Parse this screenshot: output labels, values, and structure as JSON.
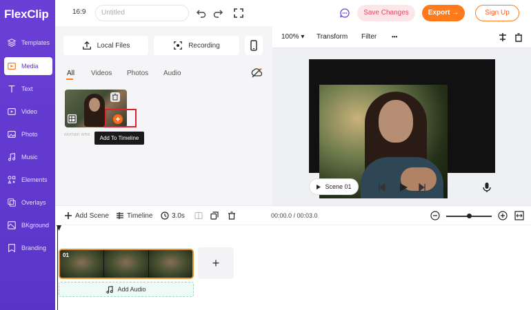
{
  "app": {
    "logo_text": "FlexClip"
  },
  "sidebar": {
    "items": [
      {
        "label": "Templates",
        "icon": "layers-icon"
      },
      {
        "label": "Media",
        "icon": "media-folder-icon"
      },
      {
        "label": "Text",
        "icon": "text-icon"
      },
      {
        "label": "Video",
        "icon": "video-icon"
      },
      {
        "label": "Photo",
        "icon": "photo-icon"
      },
      {
        "label": "Music",
        "icon": "music-icon"
      },
      {
        "label": "Elements",
        "icon": "elements-icon"
      },
      {
        "label": "Overlays",
        "icon": "overlays-icon"
      },
      {
        "label": "BKground",
        "icon": "background-icon"
      },
      {
        "label": "Branding",
        "icon": "branding-icon"
      }
    ],
    "active": "Media"
  },
  "header": {
    "ratio": "16:9",
    "title_placeholder": "Untitled",
    "save_label": "Save Changes",
    "export_label": "Export →",
    "signup_label": "Sign Up"
  },
  "media_panel": {
    "local_files_label": "Local Files",
    "recording_label": "Recording",
    "tabs": [
      "All",
      "Videos",
      "Photos",
      "Audio"
    ],
    "active_tab": "All",
    "thumb_caption": "woman wea",
    "tooltip": "Add To Timeline"
  },
  "preview": {
    "zoom": "100%",
    "transform_label": "Transform",
    "filter_label": "Filter",
    "more_label": "•••",
    "scene_label": "Scene 01"
  },
  "timeline": {
    "add_scene_label": "Add Scene",
    "timeline_label": "Timeline",
    "duration": "3.0s",
    "time_display": "00:00.0 / 00:03.0",
    "clip_number": "01",
    "add_audio_label": "Add Audio",
    "add_plus": "+",
    "zoom_level": 0.5
  },
  "colors": {
    "accent": "#ff7a1a",
    "brand": "#5a34c9",
    "highlight": "#e0202e"
  }
}
